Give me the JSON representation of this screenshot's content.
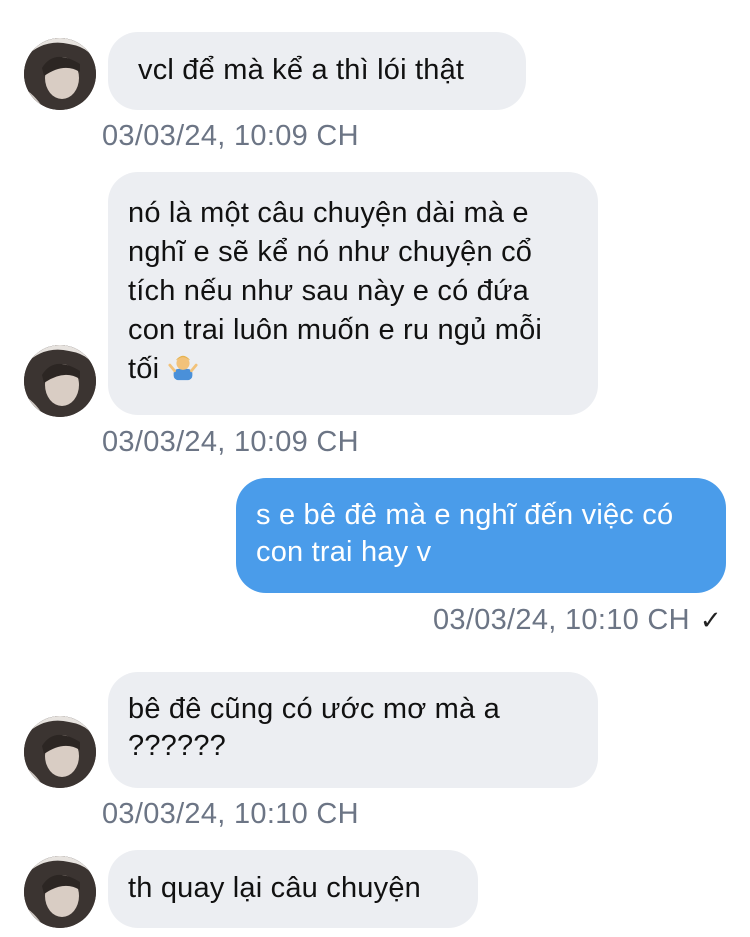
{
  "conversation": {
    "messages": [
      {
        "text": "vcl để mà kể a thì lói thật",
        "timestamp": "03/03/24, 10:09 CH"
      },
      {
        "text": "nó là một câu chuyện dài mà e nghĩ e sẽ kể nó như chuyện cổ tích nếu như sau này e có đứa con trai luôn muốn e ru ngủ mỗi tối",
        "emoji": "person-shrugging-emoji",
        "timestamp": "03/03/24, 10:09 CH"
      },
      {
        "text": "s e bê đê mà e nghĩ đến việc có con trai hay v",
        "timestamp": "03/03/24, 10:10 CH",
        "status_icon": "check-icon"
      },
      {
        "text": "bê đê cũng có ước mơ mà a ??????",
        "timestamp": "03/03/24, 10:10 CH"
      },
      {
        "text": "th quay lại câu chuyện"
      }
    ]
  },
  "colors": {
    "incoming_bubble": "#eceef2",
    "outgoing_bubble": "#4a9cea",
    "timestamp_text": "#6c7585",
    "background": "#ffffff"
  }
}
